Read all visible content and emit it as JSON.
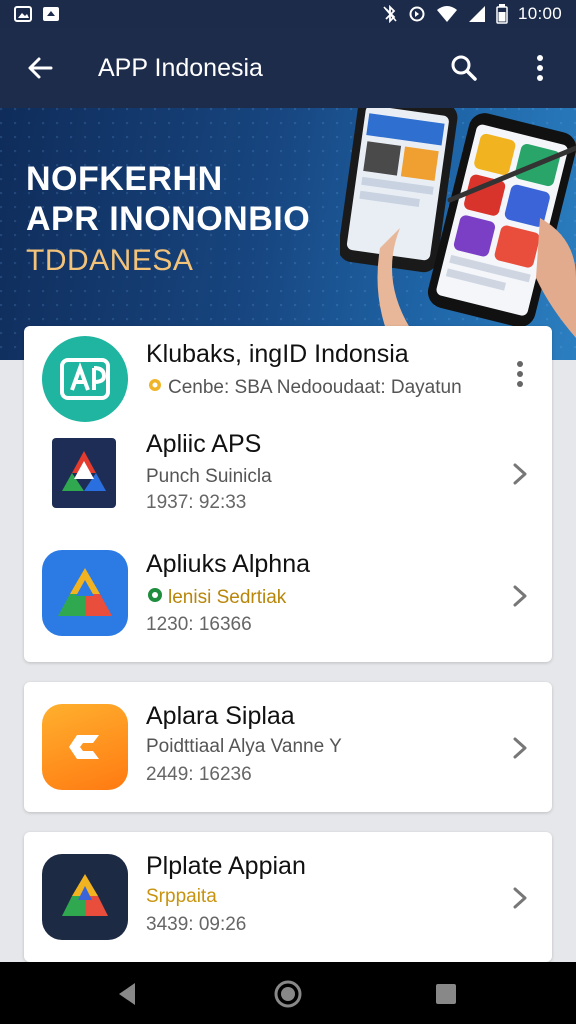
{
  "status_bar": {
    "time": "10:00",
    "left_icons": [
      "image-icon",
      "app-notification-icon"
    ],
    "right_icons": [
      "bluetooth-off-icon",
      "sync-icon",
      "wifi-icon",
      "signal-icon",
      "battery-icon"
    ]
  },
  "app_bar": {
    "title": "APP Indonesia",
    "back_icon": "arrow-left-icon",
    "search_icon": "search-icon",
    "menu_icon": "more-vert-icon"
  },
  "banner": {
    "line1": "NOFKERHN",
    "line2": "APR INONONBIO",
    "line3": "TDDANESA"
  },
  "apps": [
    {
      "title": "Klubaks, ingID Indonsia",
      "subtitle": "Cenbe: SBA Nedooudaat: Dayatun",
      "meta": "",
      "subtitle_badge": "gear-badge-icon",
      "icon": "ai-logo-icon",
      "action_icon": "more-vert-icon"
    },
    {
      "title": "Apliic APS",
      "subtitle": "Punch Suinicla",
      "meta": "1937: 92:33",
      "icon": "drive-triangle-icon",
      "action_icon": "chevron-right-icon"
    },
    {
      "title": "Apliuks Alphna",
      "subtitle": "lenisi Sedrtiak",
      "meta": "1230: 16366",
      "subtitle_badge": "green-dot-icon",
      "icon": "drive-triangle-icon",
      "action_icon": "chevron-right-icon"
    },
    {
      "title": "Aplara Siplaa",
      "subtitle": "Poidttiaal Alya Vanne Y",
      "meta": "2449: 16236",
      "icon": "c-logo-icon",
      "action_icon": "chevron-right-icon"
    },
    {
      "title": "Plplate Appian",
      "subtitle": "Srppaita",
      "meta": "3439: 09:26",
      "icon": "drive-triangle-icon",
      "action_icon": "chevron-right-icon"
    }
  ],
  "nav_bar": {
    "back_icon": "nav-back-icon",
    "home_icon": "nav-home-icon",
    "recents_icon": "nav-recents-icon"
  },
  "colors": {
    "app_bar": "#1e2c4c",
    "banner_dark": "#0f2c5a",
    "banner_light": "#2b7fc0",
    "accent_gold": "#f3c37a",
    "card_bg": "#ffffff",
    "page_bg": "#e6e7ea"
  }
}
